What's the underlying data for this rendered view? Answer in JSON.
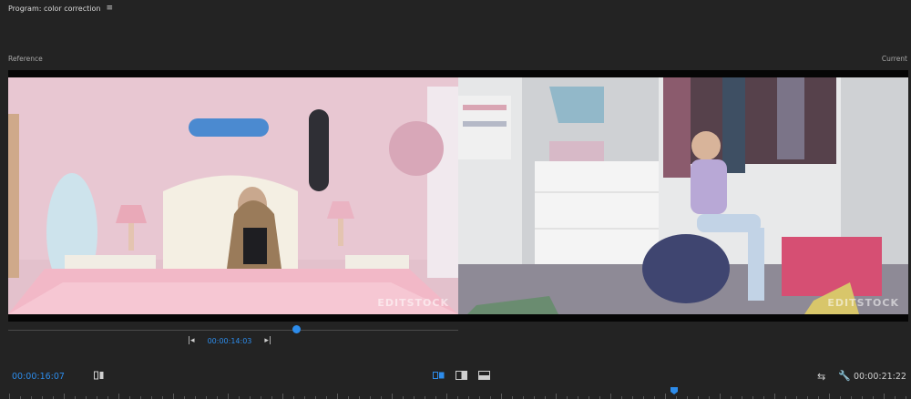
{
  "panel": {
    "title": "Program: color correction",
    "menu_icon": "hamburger-icon"
  },
  "labels": {
    "reference": "Reference",
    "current": "Current"
  },
  "viewer": {
    "watermark_left": "EDITSTOCK",
    "watermark_right": "EDITSTOCK"
  },
  "reference": {
    "timecode": "00:00:14:03",
    "playhead_position": 0.64
  },
  "bottom": {
    "current_timecode": "00:00:16:07",
    "duration": "00:00:21:22",
    "icons": [
      "mark-icon",
      "side-by-side-icon",
      "vertical-split-icon",
      "horizontal-split-icon",
      "swap-icon",
      "wrench-icon"
    ]
  },
  "timeline": {
    "playhead_position": 0.74
  },
  "colors": {
    "accent": "#2d8ceb",
    "background": "#232323"
  }
}
